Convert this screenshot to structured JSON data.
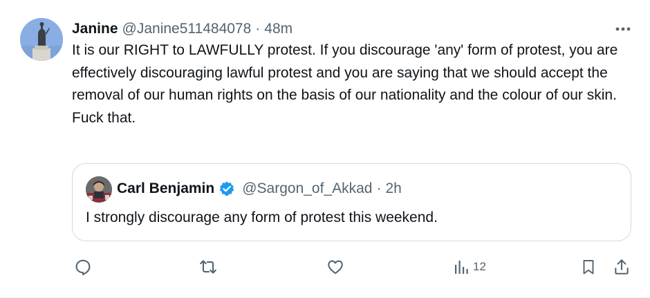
{
  "author": {
    "display_name": "Janine",
    "handle": "@Janine511484078",
    "separator": "·",
    "time": "48m"
  },
  "body": {
    "paragraph1": "It is our RIGHT to LAWFULLY protest. If you discourage 'any' form of protest, you are effectively discouraging lawful protest and you are saying that we should accept the removal of our human rights on the basis of our nationality and the colour of our skin.",
    "paragraph2": "Fuck that."
  },
  "quoted": {
    "display_name": "Carl Benjamin",
    "handle": "@Sargon_of_Akkad",
    "separator": "·",
    "time": "2h",
    "text": "I strongly discourage any form of protest this weekend."
  },
  "actions": {
    "views": "12"
  },
  "icons": {
    "more": "more-horizontal-icon",
    "verified": "verified-badge-icon",
    "reply": "reply-icon",
    "retweet": "retweet-icon",
    "like": "like-icon",
    "views": "views-icon",
    "bookmark": "bookmark-icon",
    "share": "share-icon"
  },
  "colors": {
    "text_primary": "#0f1419",
    "text_secondary": "#536471",
    "verified_blue": "#1d9bf0",
    "border": "#cfd9de"
  }
}
